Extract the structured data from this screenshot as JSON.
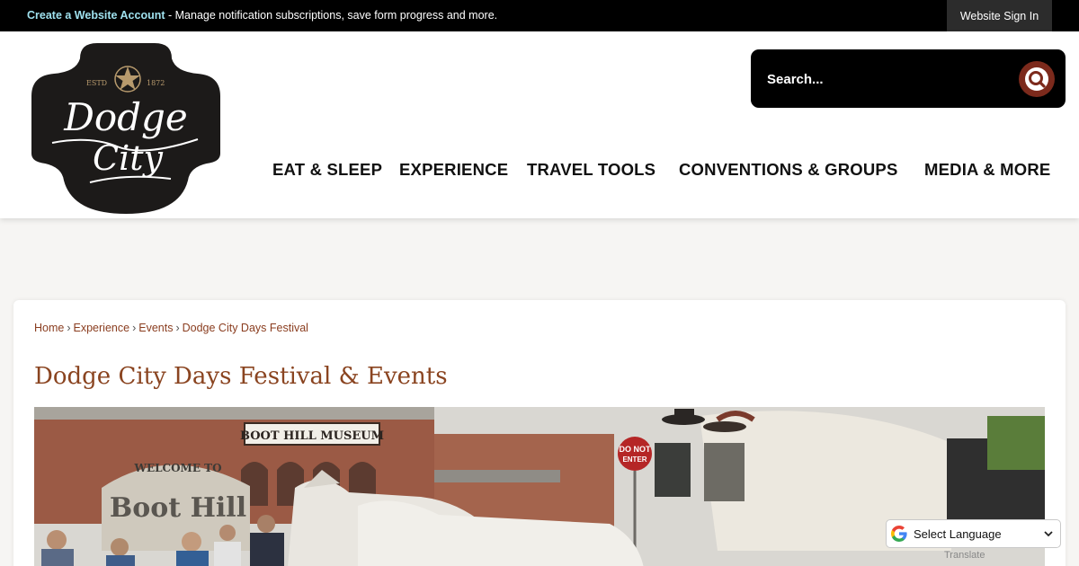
{
  "topbar": {
    "account_link": "Create a Website Account",
    "account_text": " - Manage notification subscriptions, save form progress and more.",
    "signin": "Website Sign In"
  },
  "logo": {
    "estd": "ESTD",
    "year": "1872",
    "line1": "Dodge",
    "line2": "City"
  },
  "search": {
    "placeholder": "Search...",
    "icon": "search-icon"
  },
  "nav": {
    "items": [
      "EAT & SLEEP",
      "EXPERIENCE",
      "TRAVEL TOOLS",
      "CONVENTIONS & GROUPS",
      "MEDIA & MORE"
    ]
  },
  "breadcrumb": {
    "items": [
      "Home",
      "Experience",
      "Events",
      "Dodge City Days Festival"
    ],
    "separator": "›"
  },
  "page": {
    "title": "Dodge City Days Festival & Events"
  },
  "hero": {
    "sign_museum": "BOOT HILL MUSEUM",
    "sign_welcome": "WELCOME TO",
    "sign_boothill": "Boot Hill",
    "sign_do_not": "DO NOT",
    "sign_enter": "ENTER"
  },
  "translate": {
    "label": "Select Language",
    "footer": "Translate"
  },
  "colors": {
    "brand_brown": "#8a4420",
    "search_button": "#7c2a1c",
    "topbar_bg": "#000000",
    "link_cyan": "#9fe1ee"
  }
}
